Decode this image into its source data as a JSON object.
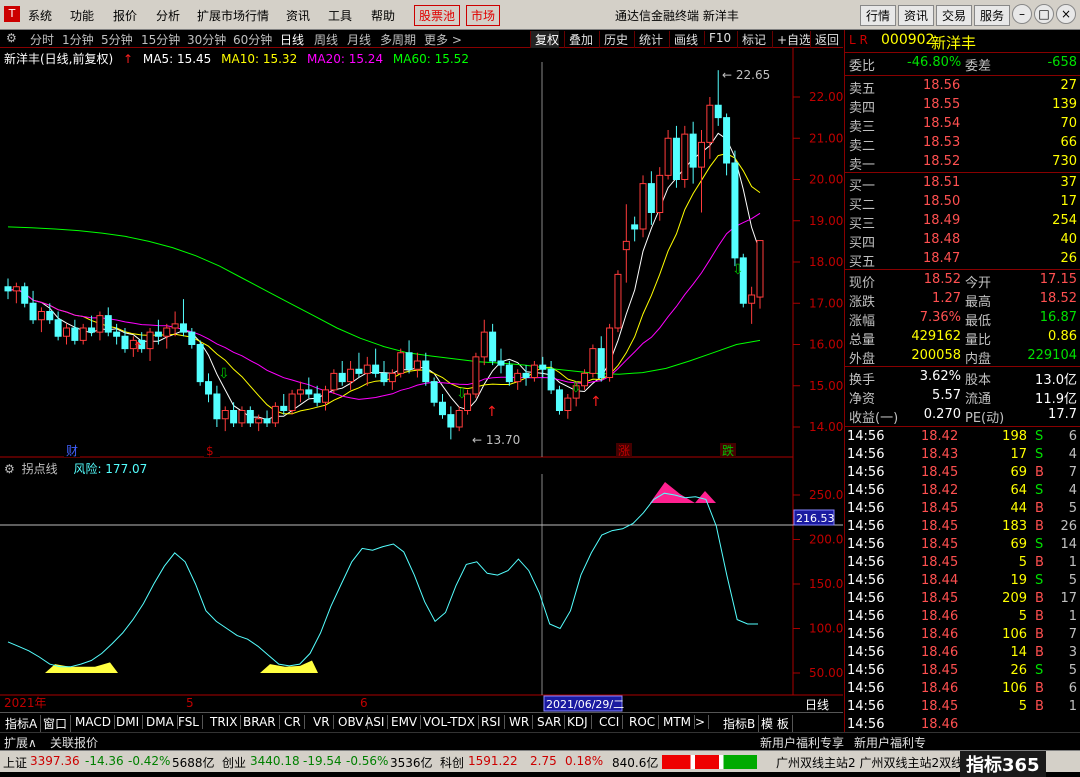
{
  "menu": {
    "items": [
      "系统",
      "功能",
      "报价",
      "分析",
      "扩展市场行情",
      "资讯",
      "工具",
      "帮助"
    ],
    "red1": "股票池",
    "red2": "市场",
    "title": "通达信金融终端  新洋丰",
    "right": [
      "行情",
      "资讯",
      "交易",
      "服务"
    ]
  },
  "period": {
    "items": [
      "分时",
      "1分钟",
      "5分钟",
      "15分钟",
      "30分钟",
      "60分钟",
      "日线",
      "周线",
      "月线",
      "多周期",
      "更多 >"
    ],
    "active": "日线",
    "tools": [
      "复权",
      "叠加",
      "历史",
      "统计",
      "画线",
      "F10",
      "标记",
      "+自选",
      "返回"
    ]
  },
  "main": {
    "name": "新洋丰(日线,前复权)",
    "ma5": "MA5: 15.45",
    "ma10": "MA10: 15.32",
    "ma20": "MA20: 15.24",
    "ma60": "MA60: 15.52",
    "hi_label": "22.65",
    "lo_label": "13.70",
    "yticks": [
      "22.00",
      "21.00",
      "20.00",
      "19.00",
      "18.00",
      "17.00",
      "16.00",
      "15.00",
      "14.00"
    ],
    "markers": [
      "财",
      "$",
      "涨",
      "跌"
    ]
  },
  "sub": {
    "name": "拐点线",
    "risk": "风险: 177.07",
    "yticks": [
      "250.0",
      "200.0",
      "150.0",
      "100.0",
      "50.00"
    ],
    "cursor_value": "216.53"
  },
  "axis": {
    "labels": [
      "2021年",
      "5",
      "6"
    ],
    "cursor_date": "2021/06/29/二",
    "period_label": "日线"
  },
  "colors": {
    "ma5": "#ffffff",
    "ma10": "#ffff00",
    "ma20": "#ff00ff",
    "ma60": "#00ff00",
    "up": "#ff3c3c",
    "down": "#54ffff"
  },
  "quote": {
    "code": "000902",
    "name": "新洋丰",
    "flags": "L R",
    "webi": "-46.80%",
    "weicha": "-658",
    "sell": [
      [
        "卖五",
        "18.56",
        "27"
      ],
      [
        "卖四",
        "18.55",
        "139"
      ],
      [
        "卖三",
        "18.54",
        "70"
      ],
      [
        "卖二",
        "18.53",
        "66"
      ],
      [
        "卖一",
        "18.52",
        "730"
      ]
    ],
    "buy": [
      [
        "买一",
        "18.51",
        "37"
      ],
      [
        "买二",
        "18.50",
        "17"
      ],
      [
        "买三",
        "18.49",
        "254"
      ],
      [
        "买四",
        "18.48",
        "40"
      ],
      [
        "买五",
        "18.47",
        "26"
      ]
    ],
    "stats": [
      [
        "现价",
        "18.52",
        "今开",
        "17.15"
      ],
      [
        "涨跌",
        "1.27",
        "最高",
        "18.52"
      ],
      [
        "涨幅",
        "7.36%",
        "最低",
        "16.87"
      ],
      [
        "总量",
        "429162",
        "量比",
        "0.86"
      ],
      [
        "外盘",
        "200058",
        "内盘",
        "229104"
      ]
    ],
    "stats2": [
      [
        "换手",
        "3.62%",
        "股本",
        "13.0亿"
      ],
      [
        "净资",
        "5.57",
        "流通",
        "11.9亿"
      ],
      [
        "收益(一)",
        "0.270",
        "PE(动)",
        "17.7"
      ]
    ]
  },
  "ticks": [
    [
      "14:56",
      "18.42",
      "198",
      "S",
      "6"
    ],
    [
      "14:56",
      "18.43",
      "17",
      "S",
      "4"
    ],
    [
      "14:56",
      "18.45",
      "69",
      "B",
      "7"
    ],
    [
      "14:56",
      "18.42",
      "64",
      "S",
      "4"
    ],
    [
      "14:56",
      "18.45",
      "44",
      "B",
      "5"
    ],
    [
      "14:56",
      "18.45",
      "183",
      "B",
      "26"
    ],
    [
      "14:56",
      "18.45",
      "69",
      "S",
      "14"
    ],
    [
      "14:56",
      "18.45",
      "5",
      "B",
      "1"
    ],
    [
      "14:56",
      "18.44",
      "19",
      "S",
      "5"
    ],
    [
      "14:56",
      "18.45",
      "209",
      "B",
      "17"
    ],
    [
      "14:56",
      "18.46",
      "5",
      "B",
      "1"
    ],
    [
      "14:56",
      "18.46",
      "106",
      "B",
      "7"
    ],
    [
      "14:56",
      "18.46",
      "14",
      "B",
      "3"
    ],
    [
      "14:56",
      "18.45",
      "26",
      "S",
      "5"
    ],
    [
      "14:56",
      "18.46",
      "106",
      "B",
      "6"
    ],
    [
      "14:56",
      "18.45",
      "5",
      "B",
      "1"
    ],
    [
      "14:56",
      "18.46",
      "",
      "",
      ""
    ]
  ],
  "tabs": [
    "指标A",
    "窗口",
    "MACD",
    "DMI",
    "DMA",
    "FSL",
    "TRIX",
    "BRAR",
    "CR",
    "VR",
    "OBV",
    "ASI",
    "EMV",
    "VOL-TDX",
    "RSI",
    "WR",
    "SAR",
    "KDJ",
    "CCI",
    "ROC",
    "MTM",
    ">",
    "指标B",
    "模 板"
  ],
  "ext": {
    "left1": "扩展∧",
    "left2": "关联报价",
    "right1": "新用户福利专享",
    "right2": "新用户福利专"
  },
  "status": {
    "sh_l": "上证",
    "sh_v": "3397.36",
    "sh_c": "-14.36",
    "sh_p": "-0.42%",
    "sh_a": "5688亿",
    "cy_l": "创业",
    "cy_v": "3440.18",
    "cy_c": "-19.54",
    "cy_p": "-0.56%",
    "cy_a": "3536亿",
    "kc_l": "科创",
    "kc_v": "1591.22",
    "kc_c": "2.75",
    "kc_p": "0.18%",
    "kc_a": "840.6亿",
    "ticker": "广州双线主站2  广州双线主站2双线主主站站2",
    "logo": "指标365"
  }
}
